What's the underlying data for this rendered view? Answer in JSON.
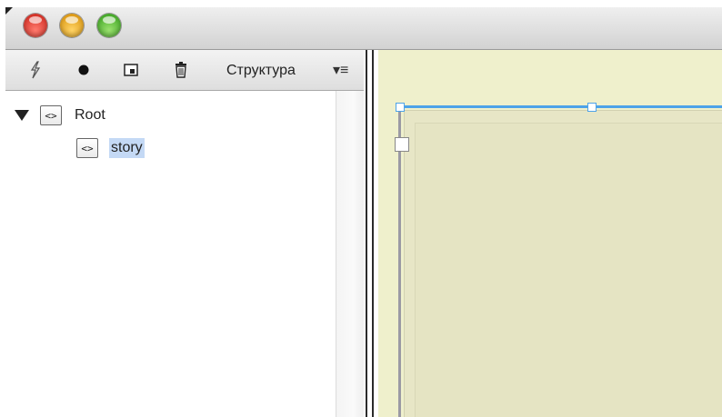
{
  "window": {
    "controls": [
      "close",
      "minimize",
      "zoom"
    ]
  },
  "panel": {
    "title": "Структура",
    "menu_glyph": "▾≡",
    "toolbar_icons": [
      "lightning-icon",
      "bullet-icon",
      "new-element-icon",
      "trash-icon"
    ],
    "tree": [
      {
        "tag_glyph": "<>",
        "label": "Root",
        "expanded": true,
        "selected": false
      },
      {
        "tag_glyph": "<>",
        "label": "story",
        "expanded": false,
        "selected": true
      }
    ]
  },
  "colors": {
    "selection": "#c4d9f5",
    "canvas": "#eff0cc",
    "frame_accent": "#4da3e8"
  }
}
